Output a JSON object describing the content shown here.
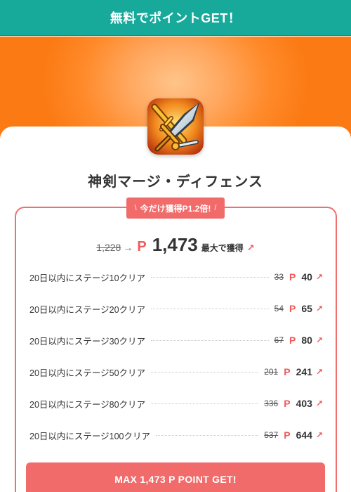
{
  "header": {
    "title": "無料でポイントGET！"
  },
  "app": {
    "name": "神剣マージ・ディフェンス",
    "icon": "sword-shield-app-icon"
  },
  "promo": {
    "deco_left": "\\",
    "text": "今だけ獲得P1.2倍!",
    "deco_right": "/"
  },
  "total": {
    "old": "1,228",
    "arrow": "→",
    "point_mark": "P",
    "new": "1,473",
    "max_label": "最大で獲得",
    "up_arrow": "↗"
  },
  "tasks": [
    {
      "label": "20日以内にステージ10クリア",
      "old": "33",
      "p": "P",
      "new": "40",
      "arrow": "↗"
    },
    {
      "label": "20日以内にステージ20クリア",
      "old": "54",
      "p": "P",
      "new": "65",
      "arrow": "↗"
    },
    {
      "label": "20日以内にステージ30クリア",
      "old": "67",
      "p": "P",
      "new": "80",
      "arrow": "↗"
    },
    {
      "label": "20日以内にステージ50クリア",
      "old": "201",
      "p": "P",
      "new": "241",
      "arrow": "↗"
    },
    {
      "label": "20日以内にステージ80クリア",
      "old": "336",
      "p": "P",
      "new": "403",
      "arrow": "↗"
    },
    {
      "label": "20日以内にステージ100クリア",
      "old": "537",
      "p": "P",
      "new": "644",
      "arrow": "↗"
    }
  ],
  "cta": {
    "label": "MAX 1,473 P POINT GET!"
  },
  "colors": {
    "header_bg": "#17a99a",
    "accent": "#f26b6b",
    "hero_orange": "#fb7a14"
  }
}
